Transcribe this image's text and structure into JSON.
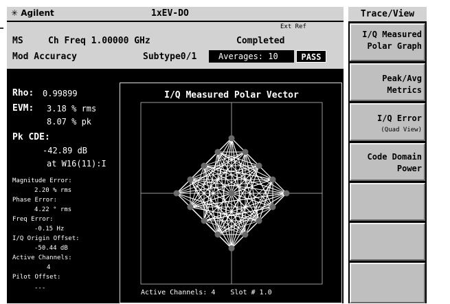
{
  "header": {
    "brand": "Agilent",
    "mode": "1xEV-DO"
  },
  "info": {
    "ext_ref": "Ext Ref",
    "device": "MS",
    "ch_freq": "Ch Freq 1.00000 GHz",
    "status": "Completed",
    "measurement": "Mod Accuracy",
    "subtype": "Subtype0/1",
    "averages": "Averages: 10",
    "pass": "PASS"
  },
  "results": {
    "rho_label": "Rho:",
    "rho_value": "0.99899",
    "evm_label": "EVM:",
    "evm_rms": "3.18 % rms",
    "evm_pk": "8.07 % pk",
    "pkcde_label": "Pk CDE:",
    "pkcde_value": "-42.89 dB",
    "pkcde_at": "at W16(11):I",
    "mag_err_label": "Magnitude Error:",
    "mag_err_value": "2.20 % rms",
    "phase_err_label": "Phase Error:",
    "phase_err_value": "4.22 ° rms",
    "freq_err_label": "Freq Error:",
    "freq_err_value": "-0.15 Hz",
    "iq_offset_label": "I/Q Origin Offset:",
    "iq_offset_value": "-50.44 dB",
    "active_ch_label": "Active Channels:",
    "active_ch_value": "4",
    "pilot_offset_label": "Pilot Offset:",
    "pilot_offset_value": "---"
  },
  "plot": {
    "title": "I/Q Measured Polar Vector",
    "footer_channels": "Active Channels: 4",
    "footer_slot": "Slot # 1.0"
  },
  "softkeys": {
    "title": "Trace/View",
    "items": [
      {
        "line1": "I/Q Measured",
        "line2": "Polar Graph",
        "sub": ""
      },
      {
        "line1": "Peak/Avg",
        "line2": "Metrics",
        "sub": ""
      },
      {
        "line1": "I/Q Error",
        "line2": "",
        "sub": "(Quad View)"
      },
      {
        "line1": "Code Domain",
        "line2": "Power",
        "sub": ""
      },
      {
        "line1": "",
        "line2": "",
        "sub": ""
      },
      {
        "line1": "",
        "line2": "",
        "sub": ""
      },
      {
        "line1": "",
        "line2": "",
        "sub": ""
      }
    ]
  },
  "colors": {
    "screen_bg": "#000000",
    "panel_gray": "#d2d2d2",
    "trace": "#ffffff",
    "points": "#6a6a6a"
  }
}
